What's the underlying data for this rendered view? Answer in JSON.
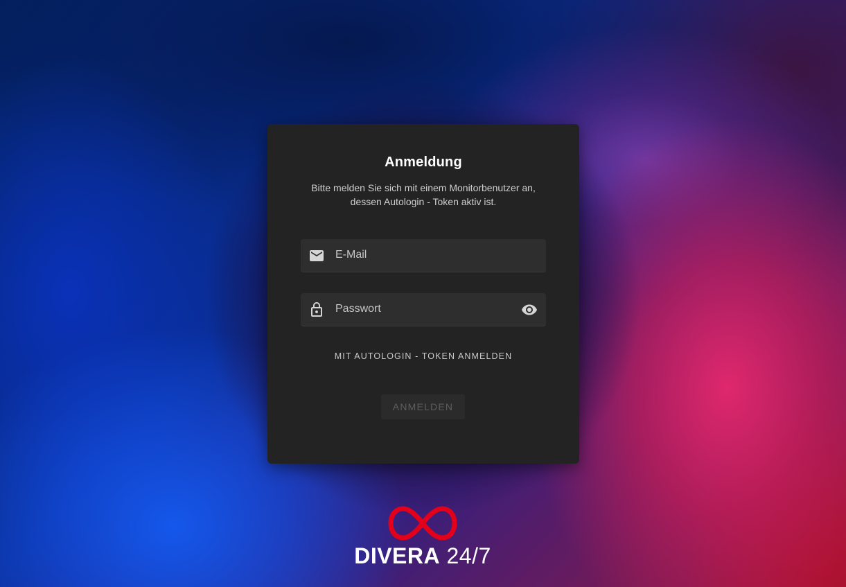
{
  "login": {
    "title": "Anmeldung",
    "subtitle": "Bitte melden Sie sich mit einem Monitorbenutzer an, dessen Autologin - Token aktiv ist.",
    "email": {
      "placeholder": "E-Mail",
      "value": "",
      "icon": "mail-icon"
    },
    "password": {
      "placeholder": "Passwort",
      "value": "",
      "icon": "lock-icon",
      "toggle_icon": "eye-icon"
    },
    "token_link": "MIT AUTOLOGIN - TOKEN ANMELDEN",
    "submit_label": "ANMELDEN"
  },
  "brand": {
    "name_bold": "DIVERA",
    "name_light": " 24/7",
    "logo_color": "#e3001b"
  },
  "colors": {
    "card_bg": "#232323",
    "field_bg": "#2e2e2e",
    "button_disabled_bg": "#2b2b2b",
    "button_disabled_text": "#5e5e5e"
  }
}
